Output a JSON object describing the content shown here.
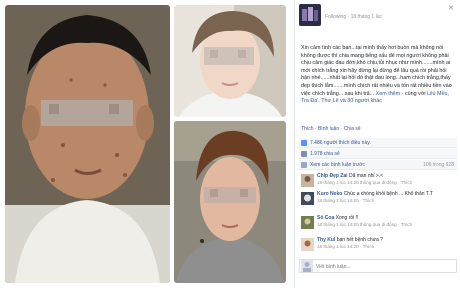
{
  "post": {
    "meta": "Following · 18 tháng 1 lúc",
    "close_glyph": "✕",
    "text": "Xin cảm tình các bạn...tại mình thấy hơi buồn mà không nói không được thì chia mang tiếng xấu để mọi người không phải chịu cảm giác đau đớn,khó chịu,tủi nhục như mình.......mình ai mới chích trắng xin hãy đừng lại đừng để lâu quá rồi phải hối hận nhé......nhất lại hối đó thật đau lòng...ham chích trắng,thấy đẹp thích lắm.......mình chích rất nhiều và tốn rất nhiều tiền vào việc chích trắng....sau khi trả...",
    "see_more": "Xem thêm",
    "with_label": "· cùng với",
    "tagged": "Lilú Mều, Tra Đa', Thư Lê và 30 người khác"
  },
  "actions": {
    "like": "Thích",
    "dot": " · ",
    "comment": "Bình luận",
    "share": "Chia sẻ"
  },
  "stats": {
    "likes": "7.486 người thích điều này.",
    "shares": "1.978 chia sẻ",
    "prev_comments": "Xem các bình luận trước",
    "comment_count": "106 trong 928"
  },
  "comments": [
    {
      "name": "Chip Đẹp Zai",
      "text": "Dã man nhỉ >.<",
      "meta": "18 tháng 1 lúc 14:20 thông qua di động · Thích"
    },
    {
      "name": "Kuro Neko",
      "text": "Chúc a chóng khỏi bệnh ... Khổ thân T.T",
      "meta": "18 tháng 1 lúc 14:20 · Thích"
    },
    {
      "name": "Sô Coa",
      "text": "Xong rồi !!",
      "meta": "18 tháng 1 lúc 14:20 thông qua di động · Thích"
    },
    {
      "name": "Thy Kul",
      "text": "bạn hết bệnh chưa ?",
      "meta": "18 tháng 1 lúc 14:20 · Thích"
    }
  ],
  "write": {
    "placeholder": "Viết bình luận..."
  },
  "colors": {
    "link": "#365899",
    "meta": "#90949c",
    "bg_row": "#f6f7f9",
    "blur_face": "#b9a79a"
  },
  "icons": {
    "like": "thumbs-up-icon",
    "share": "share-icon",
    "comment": "comment-icon",
    "close": "close-icon"
  }
}
